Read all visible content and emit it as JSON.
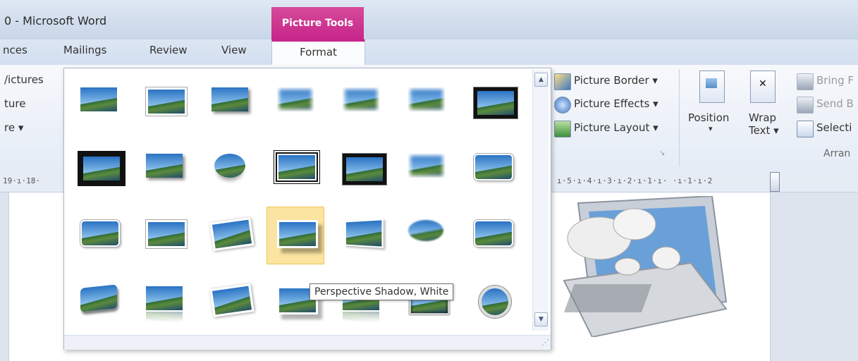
{
  "window": {
    "title": "0 - Microsoft Word",
    "context_tab_group": "Picture Tools"
  },
  "tabs": [
    "nces",
    "Mailings",
    "Review",
    "View",
    "Format"
  ],
  "ribbon": {
    "left_items": [
      "/ictures",
      "ture",
      "re ▾"
    ],
    "picture_border": "Picture Border ▾",
    "picture_effects": "Picture Effects ▾",
    "picture_layout": "Picture Layout ▾",
    "position_label": "Position",
    "position_arrow": "▾",
    "wrap_label": "Wrap",
    "wrap_sub": "Text ▾",
    "bring_forward": "Bring F",
    "send_backward": "Send B",
    "selection_pane": "Selecti",
    "arrange_group": "Arran"
  },
  "ruler": {
    "left": "19·ı·18·",
    "right": "ı·5·ı·4·ı·3·ı·2·ı·1·ı·  ·ı·1·ı·2"
  },
  "gallery": {
    "styles": [
      "simple",
      "frame",
      "shadow",
      "soft",
      "soft",
      "soft",
      "black",
      "thick",
      "shadow",
      "oval",
      "dbl",
      "black",
      "soft",
      "round",
      "round",
      "frame",
      "tilt",
      "persp-shadow",
      "persp",
      "soft-oval",
      "round",
      "3d",
      "reflect",
      "tilt",
      "persp-shadow",
      "reflect",
      "bevel",
      "circle"
    ],
    "selected_index": 17,
    "scroll_up": "▲",
    "scroll_down": "▼",
    "grip": "⋰"
  },
  "tooltip": "Perspective Shadow, White"
}
